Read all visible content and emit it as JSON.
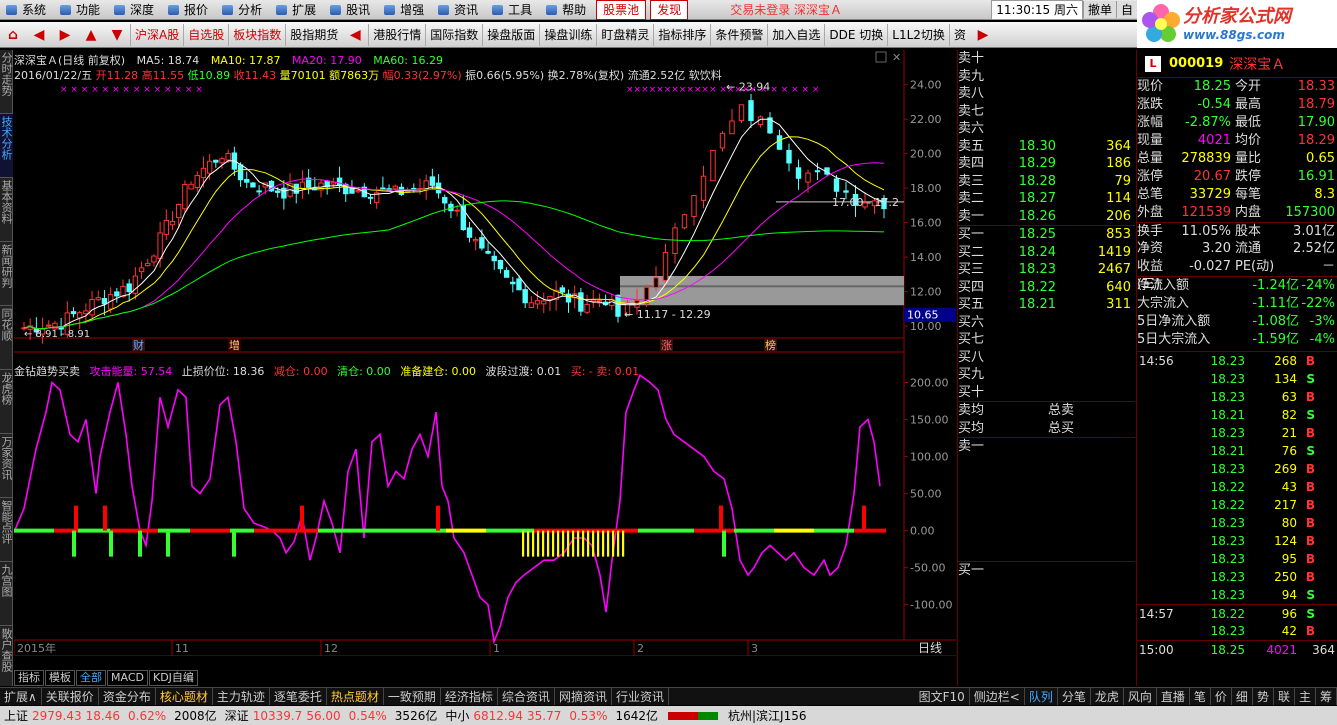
{
  "menu": [
    "系统",
    "功能",
    "深度",
    "报价",
    "分析",
    "扩展",
    "股讯",
    "增强",
    "资讯",
    "工具",
    "帮助"
  ],
  "menu_tabs": [
    "股票池",
    "发现"
  ],
  "menu_center": "交易未登录   深深宝Ａ",
  "clock": "11:30:15 周六",
  "menu_btns": [
    "撤单",
    "自"
  ],
  "logo": {
    "title": "分析家公式网",
    "url": "www.88gs.com"
  },
  "toolbar": [
    "沪深A股",
    "自选股",
    "板块指数",
    "股指期货",
    "港股行情",
    "国际指数",
    "操盘版面",
    "操盘训练",
    "盯盘精灵",
    "指标排序",
    "条件预警",
    "加入自选",
    "DDE 切换",
    "L1L2切换",
    "资"
  ],
  "leftnav": [
    "分时走势",
    "技术分析",
    "基本资料",
    "新闻研判",
    "同花顺",
    "龙虎榜",
    "万家资讯",
    "智能点评",
    "九宫图",
    "散户查股"
  ],
  "header": {
    "line1": {
      "name": "深深宝Ａ(日线 前复权)",
      "ma5": "MA5: 18.74",
      "ma10": "MA10: 17.87",
      "ma20": "MA20: 17.90",
      "ma60": "MA60: 16.29"
    },
    "line2": {
      "date": "2016/01/22/五",
      "open": "开11.28",
      "high": "高11.55",
      "low": "低10.89",
      "close": "收11.43",
      "vol": "量70101",
      "amt": "额7863万",
      "chg": "幅0.33(2.97%)",
      "amp": "振0.66(5.95%)",
      "turn": "换2.78%(复权)",
      "float": "流通2.52亿",
      "ind": "软饮料"
    },
    "line3": {
      "name": "金钻趋势买卖",
      "atk": "攻击能量: 57.54",
      "stop": "止损价位: 18.36",
      "cut": "减仓: 0.00",
      "clear": "清仓: 0.00",
      "prep": "准备建仓: 0.00",
      "wave": "波段过渡: 0.01",
      "bs": "买: -  卖: 0.01"
    }
  },
  "chart_data": {
    "type": "candlestick",
    "main_ylabels": [
      "24.00",
      "22.00",
      "20.00",
      "18.00",
      "16.00",
      "14.00",
      "12.00",
      "10.00"
    ],
    "main_ylim": [
      9.3,
      25.2
    ],
    "sub_ylabels": [
      "200.00",
      "150.00",
      "100.00",
      "50.00",
      "0.00",
      "-50.00",
      "-100.00"
    ],
    "sub_ylim": [
      -145,
      225
    ],
    "xlabels": [
      "2015年",
      "11",
      "12",
      "1",
      "2",
      "3"
    ],
    "annotations": [
      "23.94",
      "17.00 - 17.2",
      "11.17 - 12.29",
      "8.91 - 8.91"
    ],
    "price_tag": "10.65",
    "events": [
      "财",
      "增",
      "涨",
      "榜"
    ],
    "period": "日线"
  },
  "orderbook": {
    "sells": [
      [
        "卖十",
        "",
        ""
      ],
      [
        "卖九",
        "",
        ""
      ],
      [
        "卖八",
        "",
        ""
      ],
      [
        "卖七",
        "",
        ""
      ],
      [
        "卖六",
        "",
        ""
      ],
      [
        "卖五",
        "18.30",
        "364"
      ],
      [
        "卖四",
        "18.29",
        "186"
      ],
      [
        "卖三",
        "18.28",
        "79"
      ],
      [
        "卖二",
        "18.27",
        "114"
      ],
      [
        "卖一",
        "18.26",
        "206"
      ]
    ],
    "buys": [
      [
        "买一",
        "18.25",
        "853"
      ],
      [
        "买二",
        "18.24",
        "1419"
      ],
      [
        "买三",
        "18.23",
        "2467"
      ],
      [
        "买四",
        "18.22",
        "640"
      ],
      [
        "买五",
        "18.21",
        "311"
      ],
      [
        "买六",
        "",
        ""
      ],
      [
        "买七",
        "",
        ""
      ],
      [
        "买八",
        "",
        ""
      ],
      [
        "买九",
        "",
        ""
      ],
      [
        "买十",
        "",
        ""
      ]
    ],
    "avg": [
      [
        "卖均",
        "总卖"
      ],
      [
        "买均",
        "总买"
      ]
    ],
    "q1": "卖一",
    "q2": "买一"
  },
  "quote": {
    "code": "000019",
    "name": "深深宝Ａ",
    "flag": "L",
    "rows": [
      [
        "现价",
        "18.25",
        "今开",
        "18.33"
      ],
      [
        "涨跌",
        "-0.54",
        "最高",
        "18.79"
      ],
      [
        "涨幅",
        "-2.87%",
        "最低",
        "17.90"
      ],
      [
        "现量",
        "4021",
        "均价",
        "18.29"
      ],
      [
        "总量",
        "278839",
        "量比",
        "0.65"
      ],
      [
        "涨停",
        "20.67",
        "跌停",
        "16.91"
      ],
      [
        "总笔",
        "33729",
        "每笔",
        "8.3"
      ],
      [
        "外盘",
        "121539",
        "内盘",
        "157300"
      ],
      [
        "换手",
        "11.05%",
        "股本",
        "3.01亿"
      ],
      [
        "净资",
        "3.20",
        "流通",
        "2.52亿"
      ],
      [
        "收益(三)",
        "-0.027",
        "PE(动)",
        "－"
      ]
    ],
    "flows": [
      [
        "净流入额",
        "-1.24亿",
        "-24%"
      ],
      [
        "大宗流入",
        "-1.11亿",
        "-22%"
      ],
      [
        "5日净流入额",
        "-1.08亿",
        "-3%"
      ],
      [
        "5日大宗流入",
        "-1.59亿",
        "-4%"
      ]
    ],
    "ticks": [
      [
        "14:56",
        "18.23",
        "268",
        "B"
      ],
      [
        "",
        "18.23",
        "134",
        "S"
      ],
      [
        "",
        "18.23",
        "63",
        "B"
      ],
      [
        "",
        "18.21",
        "82",
        "S"
      ],
      [
        "",
        "18.23",
        "21",
        "B"
      ],
      [
        "",
        "18.21",
        "76",
        "S"
      ],
      [
        "",
        "18.23",
        "269",
        "B"
      ],
      [
        "",
        "18.22",
        "43",
        "B"
      ],
      [
        "",
        "18.22",
        "217",
        "B"
      ],
      [
        "",
        "18.23",
        "80",
        "B"
      ],
      [
        "",
        "18.23",
        "124",
        "B"
      ],
      [
        "",
        "18.23",
        "95",
        "B"
      ],
      [
        "",
        "18.23",
        "250",
        "B"
      ],
      [
        "",
        "18.23",
        "94",
        "S"
      ],
      [
        "14:57",
        "18.22",
        "96",
        "S"
      ],
      [
        "",
        "18.23",
        "42",
        "B"
      ],
      [
        "15:00",
        "18.25",
        "4021",
        "364"
      ]
    ]
  },
  "bottom_tabs": [
    "指标",
    "模板",
    "全部",
    "MACD",
    "KDJ自编"
  ],
  "footbar": [
    "扩展∧",
    "关联报价",
    "资金分布",
    "核心题材",
    "主力轨迹",
    "逐笔委托",
    "热点题材",
    "一致预期",
    "经济指标",
    "综合资讯",
    "网摘资讯",
    "行业资讯"
  ],
  "footbar_right": [
    "图文F10",
    "侧边栏<",
    "队列",
    "分笔",
    "龙虎",
    "风向",
    "直播",
    "笔",
    "价",
    "细",
    "势",
    "联",
    "主",
    "筹"
  ],
  "status": {
    "sh": "上证",
    "sh_v": "2979.43",
    "sh_c": "18.46",
    "sh_p": "0.62%",
    "sh_a": "2008亿",
    "sz": "深证",
    "sz_v": "10339.7",
    "sz_c": "56.00",
    "sz_p": "0.54%",
    "sz_a": "3526亿",
    "zx": "中小",
    "zx_v": "6812.94",
    "zx_c": "35.77",
    "zx_p": "0.53%",
    "zx_a": "1642亿",
    "loc": "杭州|滨江J156"
  },
  "colors": {
    "up": "#ff3333",
    "down": "#54ffff",
    "ma5": "#ffffff",
    "ma10": "#ffff00",
    "ma20": "#ff00ff",
    "ma60": "#00ff00"
  }
}
